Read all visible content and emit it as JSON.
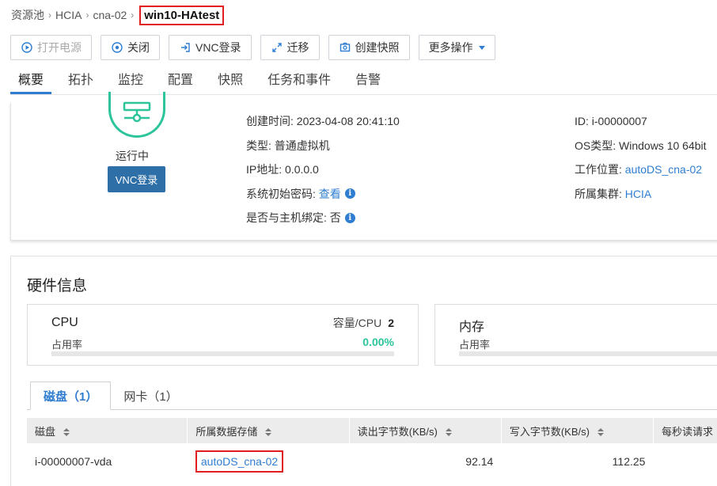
{
  "breadcrumb": {
    "items": [
      "资源池",
      "HCIA",
      "cna-02"
    ],
    "current": "win10-HAtest"
  },
  "toolbar": {
    "power_on": "打开电源",
    "shutdown": "关闭",
    "vnc_login": "VNC登录",
    "migrate": "迁移",
    "snapshot": "创建快照",
    "more": "更多操作"
  },
  "tabs": [
    "概要",
    "拓扑",
    "监控",
    "配置",
    "快照",
    "任务和事件",
    "告警"
  ],
  "summary": {
    "status": "运行中",
    "vnc_button": "VNC登录",
    "created_label": "创建时间:",
    "created_value": "2023-04-08 20:41:10",
    "type_label": "类型:",
    "type_value": "普通虚拟机",
    "ip_label": "IP地址:",
    "ip_value": "0.0.0.0",
    "init_pwd_label": "系统初始密码:",
    "init_pwd_link": "查看",
    "bind_label": "是否与主机绑定:",
    "bind_value": "否",
    "id_label": "ID:",
    "id_value": "i-00000007",
    "os_label": "OS类型:",
    "os_value": "Windows 10 64bit",
    "location_label": "工作位置:",
    "location_value": "autoDS_cna-02",
    "cluster_label": "所属集群:",
    "cluster_value": "HCIA"
  },
  "hardware": {
    "title": "硬件信息",
    "cpu": {
      "name": "CPU",
      "sub": "占用率",
      "cap_label": "容量/CPU",
      "cap_value": "2",
      "usage_text": "0.00%",
      "usage_fraction": 0.0
    },
    "memory": {
      "name": "内存",
      "sub": "占用率"
    },
    "subtabs": {
      "disk": "磁盘（1）",
      "nic": "网卡（1）"
    },
    "table": {
      "headers": [
        "磁盘",
        "所属数据存储",
        "读出字节数(KB/s)",
        "写入字节数(KB/s)",
        "每秒读请求"
      ],
      "rows": [
        {
          "disk": "i-00000007-vda",
          "datastore": "autoDS_cna-02",
          "read": "92.14",
          "write": "112.25",
          "rps": ""
        }
      ]
    }
  },
  "colors": {
    "accent": "#2f7dd1",
    "ok": "#2bc49b",
    "highlight": "#e01e1e",
    "vnc_bg": "#2f6fa8"
  }
}
